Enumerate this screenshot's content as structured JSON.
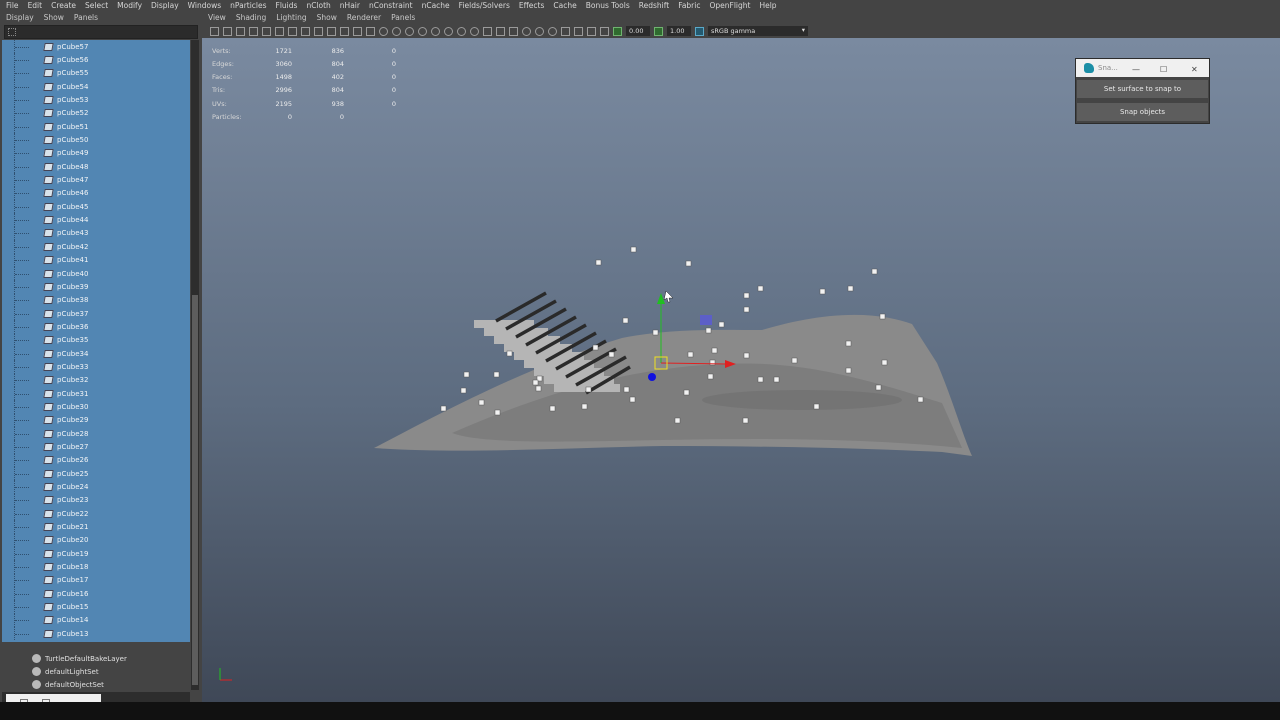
{
  "menubar": [
    "File",
    "Edit",
    "Create",
    "Select",
    "Modify",
    "Display",
    "Windows",
    "nParticles",
    "Fluids",
    "nCloth",
    "nHair",
    "nConstraint",
    "nCache",
    "Fields/Solvers",
    "Effects",
    "Cache",
    "Bonus Tools",
    "Redshift",
    "Fabric",
    "OpenFlight",
    "Help"
  ],
  "outliner": {
    "menu": [
      "Display",
      "Show",
      "Panels"
    ],
    "items": [
      "pCube57",
      "pCube56",
      "pCube55",
      "pCube54",
      "pCube53",
      "pCube52",
      "pCube51",
      "pCube50",
      "pCube49",
      "pCube48",
      "pCube47",
      "pCube46",
      "pCube45",
      "pCube44",
      "pCube43",
      "pCube42",
      "pCube41",
      "pCube40",
      "pCube39",
      "pCube38",
      "pCube37",
      "pCube36",
      "pCube35",
      "pCube34",
      "pCube33",
      "pCube32",
      "pCube31",
      "pCube30",
      "pCube29",
      "pCube28",
      "pCube27",
      "pCube26",
      "pCube25",
      "pCube24",
      "pCube23",
      "pCube22",
      "pCube21",
      "pCube20",
      "pCube19",
      "pCube18",
      "pCube17",
      "pCube16",
      "pCube15",
      "pCube14",
      "pCube13"
    ],
    "sets": [
      "TurtleDefaultBakeLayer",
      "defaultLightSet",
      "defaultObjectSet"
    ]
  },
  "viewport": {
    "menu": [
      "View",
      "Shading",
      "Lighting",
      "Show",
      "Renderer",
      "Panels"
    ],
    "field1": "0.00",
    "field2": "1.00",
    "color_space": "sRGB gamma",
    "hud": [
      {
        "k": "Verts:",
        "a": "1721",
        "b": "836",
        "c": "0"
      },
      {
        "k": "Edges:",
        "a": "3060",
        "b": "804",
        "c": "0"
      },
      {
        "k": "Faces:",
        "a": "1498",
        "b": "402",
        "c": "0"
      },
      {
        "k": "Tris:",
        "a": "2996",
        "b": "804",
        "c": "0"
      },
      {
        "k": "UVs:",
        "a": "2195",
        "b": "938",
        "c": "0"
      },
      {
        "k": "Particles:",
        "a": "0",
        "b": "0",
        "c": ""
      }
    ]
  },
  "snap": {
    "title": "Sna...",
    "set_surface": "Set surface to snap to",
    "snap_objects": "Snap objects"
  },
  "colors": {
    "outliner_selected": "#5286b3",
    "panel": "#444444",
    "manip_x": "#e02020",
    "manip_y": "#20c020"
  }
}
